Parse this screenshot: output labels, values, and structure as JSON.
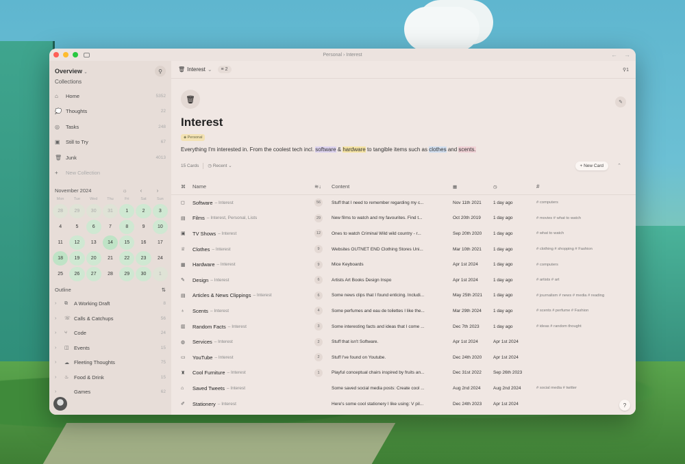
{
  "window": {
    "title_path": "Personal",
    "title_current": "Interest",
    "traffic_colors": [
      "#ff5f57",
      "#febc2e",
      "#28c840"
    ]
  },
  "sidebar": {
    "overview_label": "Overview",
    "collections_label": "Collections",
    "collections": [
      {
        "icon": "home-icon",
        "glyph": "⌂",
        "label": "Home",
        "count": "5352"
      },
      {
        "icon": "thoughts-icon",
        "glyph": "💭",
        "label": "Thoughts",
        "count": "22"
      },
      {
        "icon": "tasks-icon",
        "glyph": "◎",
        "label": "Tasks",
        "count": "248"
      },
      {
        "icon": "still-to-try-icon",
        "glyph": "▣",
        "label": "Still to Try",
        "count": "67"
      },
      {
        "icon": "junk-icon",
        "glyph": "🗑",
        "label": "Junk",
        "count": "4013"
      }
    ],
    "new_collection_label": "New Collection",
    "calendar": {
      "month_label": "November 2024",
      "dow": [
        "Mon",
        "Tue",
        "Wed",
        "Thu",
        "Fri",
        "Sat",
        "Sun"
      ],
      "days": [
        {
          "n": "28",
          "s": "muted"
        },
        {
          "n": "29",
          "s": "muted"
        },
        {
          "n": "30",
          "s": "muted"
        },
        {
          "n": "31",
          "s": "muted"
        },
        {
          "n": "1",
          "s": "active"
        },
        {
          "n": "2",
          "s": "active"
        },
        {
          "n": "3",
          "s": "active"
        },
        {
          "n": "4",
          "s": ""
        },
        {
          "n": "5",
          "s": ""
        },
        {
          "n": "6",
          "s": "active"
        },
        {
          "n": "7",
          "s": ""
        },
        {
          "n": "8",
          "s": "active"
        },
        {
          "n": "9",
          "s": ""
        },
        {
          "n": "10",
          "s": "active"
        },
        {
          "n": "11",
          "s": ""
        },
        {
          "n": "12",
          "s": "active"
        },
        {
          "n": "13",
          "s": ""
        },
        {
          "n": "14",
          "s": "hi"
        },
        {
          "n": "15",
          "s": "active"
        },
        {
          "n": "16",
          "s": ""
        },
        {
          "n": "17",
          "s": ""
        },
        {
          "n": "18",
          "s": "hi"
        },
        {
          "n": "19",
          "s": "active"
        },
        {
          "n": "20",
          "s": "active"
        },
        {
          "n": "21",
          "s": ""
        },
        {
          "n": "22",
          "s": "active"
        },
        {
          "n": "23",
          "s": "active"
        },
        {
          "n": "24",
          "s": ""
        },
        {
          "n": "25",
          "s": ""
        },
        {
          "n": "26",
          "s": "active"
        },
        {
          "n": "27",
          "s": "active"
        },
        {
          "n": "28",
          "s": ""
        },
        {
          "n": "29",
          "s": "active"
        },
        {
          "n": "30",
          "s": "active"
        },
        {
          "n": "1",
          "s": "muted"
        }
      ]
    },
    "outline_label": "Outline",
    "outline": [
      {
        "glyph": "⧉",
        "label": "A Working Draft",
        "count": "8"
      },
      {
        "glyph": "☏",
        "label": "Calls & Catchups",
        "count": "56"
      },
      {
        "glyph": "⑂",
        "label": "Code",
        "count": "24"
      },
      {
        "glyph": "◫",
        "label": "Events",
        "count": "15"
      },
      {
        "glyph": "☁",
        "label": "Fleeting Thoughts",
        "count": "75"
      },
      {
        "glyph": "♨",
        "label": "Food & Drink",
        "count": "15"
      },
      {
        "glyph": "",
        "label": "Games",
        "count": "62"
      }
    ]
  },
  "main": {
    "breadcrumb_label": "Interest",
    "filter_count": "2",
    "pin_count": "1",
    "title": "Interest",
    "tag": "Personal",
    "desc": {
      "p1": "Everything I'm interested in. From the coolest tech incl.",
      "w1": "software",
      "p2": "&",
      "w2": "hardware",
      "p3": "to tangible items such as",
      "w3": "clothes",
      "p4": "and",
      "w4": "scents."
    },
    "cards_count": "15 Cards",
    "sort_label": "Recent",
    "new_card_label": "+ New Card",
    "columns": {
      "name": "Name",
      "content": "Content"
    },
    "rows": [
      {
        "glyph": "◻",
        "name": "Software",
        "sub": "– Interest",
        "count": "56",
        "content": "Stuff that I need to remember regarding my c...",
        "date": "Nov 11th 2021",
        "updated": "1 day ago",
        "tags": "# computers"
      },
      {
        "glyph": "▤",
        "name": "Films",
        "sub": "– Interest, Personal, Lists",
        "count": "29",
        "content": "New films to watch and my favourites. Find t...",
        "date": "Oct 20th 2019",
        "updated": "1 day ago",
        "tags": "# movies   # what to watch"
      },
      {
        "glyph": "▣",
        "name": "TV Shows",
        "sub": "– Interest",
        "count": "12",
        "content": "Ones to watch Criminal Wild wild country - r...",
        "date": "Sep 20th 2020",
        "updated": "1 day ago",
        "tags": "# what to watch"
      },
      {
        "glyph": "♕",
        "name": "Clothes",
        "sub": "– Interest",
        "count": "9",
        "content": "Websites OUTNET END Clothing Stores Uni...",
        "date": "Mar 10th 2021",
        "updated": "1 day ago",
        "tags": "# clothing   # shopping   # Fashion"
      },
      {
        "glyph": "▦",
        "name": "Hardware",
        "sub": "– Interest",
        "count": "9",
        "content": "Mice Keyboards",
        "date": "Apr 1st 2024",
        "updated": "1 day ago",
        "tags": "# computers"
      },
      {
        "glyph": "✎",
        "name": "Design",
        "sub": "– Interest",
        "count": "6",
        "content": "Artists Art Books Design Inspo",
        "date": "Apr 1st 2024",
        "updated": "1 day ago",
        "tags": "# artists   # art"
      },
      {
        "glyph": "▤",
        "name": "Articles & News Clippings",
        "sub": "– Interest",
        "count": "6",
        "content": "Some news clips that I found enticing. Includi...",
        "date": "May 25th 2021",
        "updated": "1 day ago",
        "tags": "# journalism   # news   # media   # reading"
      },
      {
        "glyph": "♁",
        "name": "Scents",
        "sub": "– Interest",
        "count": "4",
        "content": "Some perfumes and eau de toilettes I like the...",
        "date": "Mar 29th 2024",
        "updated": "1 day ago",
        "tags": "# scents   # perfume   # Fashion"
      },
      {
        "glyph": "▥",
        "name": "Random Facts",
        "sub": "– Interest",
        "count": "3",
        "content": "Some interesting facts and ideas that I come ...",
        "date": "Dec 7th 2023",
        "updated": "1 day ago",
        "tags": "# ideas   # random thought"
      },
      {
        "glyph": "◍",
        "name": "Services",
        "sub": "– Interest",
        "count": "2",
        "content": "Stuff that isn't Software.",
        "date": "Apr 1st 2024",
        "updated": "Apr 1st 2024",
        "tags": ""
      },
      {
        "glyph": "▭",
        "name": "YouTube",
        "sub": "– Interest",
        "count": "2",
        "content": "Stuff I've found on Youtube.",
        "date": "Dec 24th 2020",
        "updated": "Apr 1st 2024",
        "tags": ""
      },
      {
        "glyph": "♜",
        "name": "Cool Furniture",
        "sub": "– Interest",
        "count": "1",
        "content": "Playful conceptual chairs inspired by fruits an...",
        "date": "Dec 31st 2022",
        "updated": "Sep 26th 2023",
        "tags": ""
      },
      {
        "glyph": "⌂",
        "name": "Saved Tweets",
        "sub": "– Interest",
        "count": "",
        "content": "Some saved social media posts: Create cool ...",
        "date": "Aug 2nd 2024",
        "updated": "Aug 2nd 2024",
        "tags": "# social media   # twitter"
      },
      {
        "glyph": "✐",
        "name": "Stationery",
        "sub": "– Interest",
        "count": "",
        "content": "Here's some cool stationery I like using: V pil...",
        "date": "Dec 24th 2023",
        "updated": "Apr 1st 2024",
        "tags": ""
      }
    ]
  }
}
